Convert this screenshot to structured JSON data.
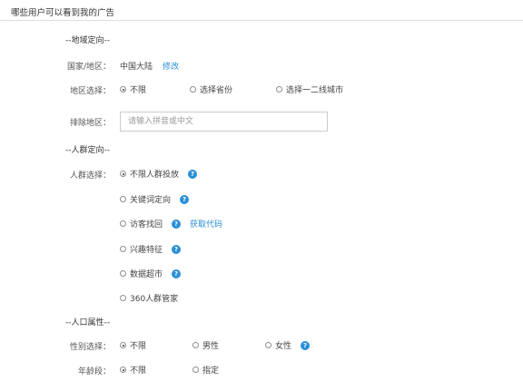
{
  "header": {
    "title": "哪些用户可以看到我的广告"
  },
  "region": {
    "section_title": "--地域定向--",
    "country": {
      "label": "国家/地区：",
      "value": "中国大陆",
      "edit_link": "修改"
    },
    "region_select": {
      "label": "地区选择：",
      "options": [
        "不限",
        "选择省份",
        "选择一二线城市"
      ],
      "selected": "不限"
    },
    "exclude": {
      "label": "排除地区：",
      "placeholder": "请输入拼音或中文"
    }
  },
  "audience": {
    "section_title": "--人群定向--",
    "label": "人群选择：",
    "options": [
      "不限人群投放",
      "关键词定向",
      "访客找回",
      "兴趣特征",
      "数据超市",
      "360人群管家"
    ],
    "selected": "不限人群投放",
    "get_code_link": "获取代码"
  },
  "demographics": {
    "section_title": "--人口属性--",
    "gender": {
      "label": "性别选择：",
      "options": [
        "不限",
        "男性",
        "女性"
      ],
      "selected": "不限"
    },
    "age": {
      "label": "年龄段：",
      "options": [
        "不限",
        "指定"
      ],
      "selected": "不限"
    }
  },
  "icons": {
    "help": "help-question-icon",
    "radio": "radio-button-icon"
  },
  "colors": {
    "link": "#2a8fd6",
    "help_icon": "#2a8fd6",
    "divider": "#dddddd"
  }
}
